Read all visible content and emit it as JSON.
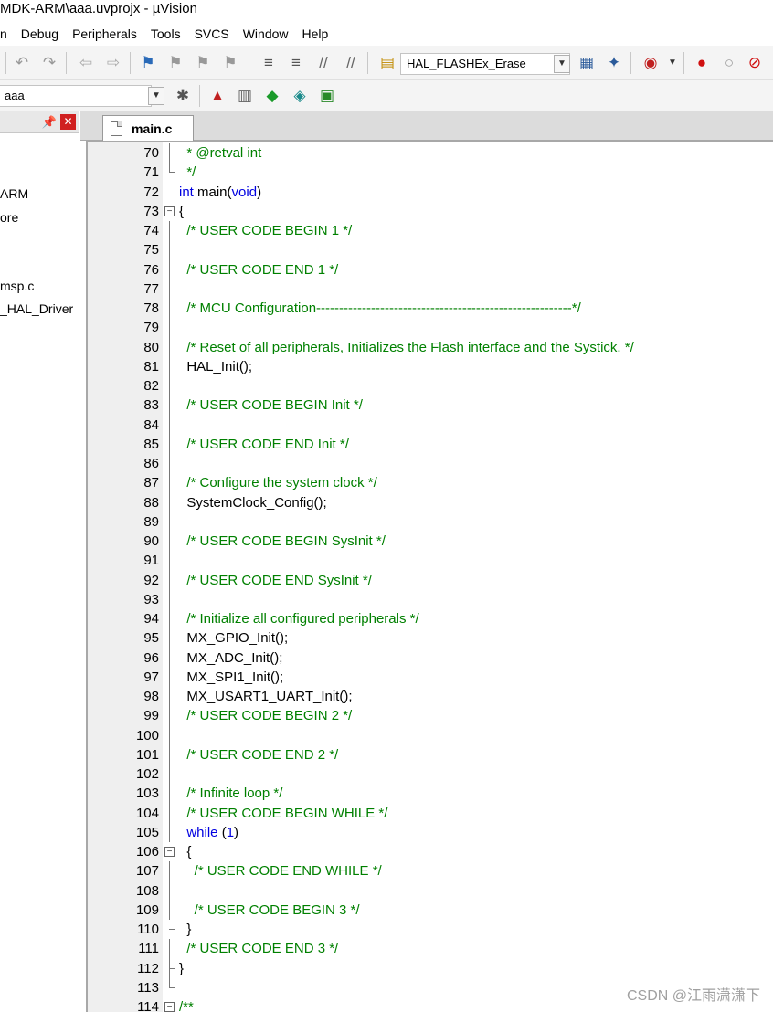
{
  "window": {
    "title": "MDK-ARM\\aaa.uvprojx - µVision"
  },
  "menu": [
    "n",
    "Debug",
    "Peripherals",
    "Tools",
    "SVCS",
    "Window",
    "Help"
  ],
  "toolbar": {
    "function_combo": "HAL_FLASHEx_Erase"
  },
  "toolbar2": {
    "target_combo": "aaa"
  },
  "project": {
    "items": [
      "ARM",
      "ore",
      "msp.c",
      "_HAL_Driver"
    ]
  },
  "tab": {
    "label": "main.c"
  },
  "code_lines": [
    {
      "n": "70",
      "t": "  * @retval int",
      "c": "c"
    },
    {
      "n": "71",
      "t": "  */",
      "c": "c"
    },
    {
      "n": "72",
      "t": "int main(void)",
      "c": "m"
    },
    {
      "n": "73",
      "t": "{",
      "c": "n"
    },
    {
      "n": "74",
      "t": "  /* USER CODE BEGIN 1 */",
      "c": "c"
    },
    {
      "n": "75",
      "t": "",
      "c": "n"
    },
    {
      "n": "76",
      "t": "  /* USER CODE END 1 */",
      "c": "c"
    },
    {
      "n": "77",
      "t": "",
      "c": "n"
    },
    {
      "n": "78",
      "t": "  /* MCU Configuration--------------------------------------------------------*/",
      "c": "c"
    },
    {
      "n": "79",
      "t": "",
      "c": "n"
    },
    {
      "n": "80",
      "t": "  /* Reset of all peripherals, Initializes the Flash interface and the Systick. */",
      "c": "c"
    },
    {
      "n": "81",
      "t": "  HAL_Init();",
      "c": "n"
    },
    {
      "n": "82",
      "t": "",
      "c": "n"
    },
    {
      "n": "83",
      "t": "  /* USER CODE BEGIN Init */",
      "c": "c"
    },
    {
      "n": "84",
      "t": "",
      "c": "n"
    },
    {
      "n": "85",
      "t": "  /* USER CODE END Init */",
      "c": "c"
    },
    {
      "n": "86",
      "t": "",
      "c": "n"
    },
    {
      "n": "87",
      "t": "  /* Configure the system clock */",
      "c": "c"
    },
    {
      "n": "88",
      "t": "  SystemClock_Config();",
      "c": "n"
    },
    {
      "n": "89",
      "t": "",
      "c": "n"
    },
    {
      "n": "90",
      "t": "  /* USER CODE BEGIN SysInit */",
      "c": "c"
    },
    {
      "n": "91",
      "t": "",
      "c": "n"
    },
    {
      "n": "92",
      "t": "  /* USER CODE END SysInit */",
      "c": "c"
    },
    {
      "n": "93",
      "t": "",
      "c": "n"
    },
    {
      "n": "94",
      "t": "  /* Initialize all configured peripherals */",
      "c": "c"
    },
    {
      "n": "95",
      "t": "  MX_GPIO_Init();",
      "c": "n"
    },
    {
      "n": "96",
      "t": "  MX_ADC_Init();",
      "c": "n"
    },
    {
      "n": "97",
      "t": "  MX_SPI1_Init();",
      "c": "n"
    },
    {
      "n": "98",
      "t": "  MX_USART1_UART_Init();",
      "c": "n"
    },
    {
      "n": "99",
      "t": "  /* USER CODE BEGIN 2 */",
      "c": "c"
    },
    {
      "n": "100",
      "t": "",
      "c": "n"
    },
    {
      "n": "101",
      "t": "  /* USER CODE END 2 */",
      "c": "c"
    },
    {
      "n": "102",
      "t": "",
      "c": "n"
    },
    {
      "n": "103",
      "t": "  /* Infinite loop */",
      "c": "c"
    },
    {
      "n": "104",
      "t": "  /* USER CODE BEGIN WHILE */",
      "c": "c"
    },
    {
      "n": "105",
      "t": "  while (1)",
      "c": "w"
    },
    {
      "n": "106",
      "t": "  {",
      "c": "n"
    },
    {
      "n": "107",
      "t": "    /* USER CODE END WHILE */",
      "c": "c"
    },
    {
      "n": "108",
      "t": "",
      "c": "n"
    },
    {
      "n": "109",
      "t": "    /* USER CODE BEGIN 3 */",
      "c": "c"
    },
    {
      "n": "110",
      "t": "  }",
      "c": "n"
    },
    {
      "n": "111",
      "t": "  /* USER CODE END 3 */",
      "c": "c"
    },
    {
      "n": "112",
      "t": "}",
      "c": "n"
    },
    {
      "n": "113",
      "t": "",
      "c": "n"
    },
    {
      "n": "114",
      "t": "/**",
      "c": "c"
    }
  ],
  "watermark": "CSDN @江雨潇潇下",
  "colors": {
    "comment": "#008000",
    "keyword": "#0000e0",
    "gutter": "#efefef"
  }
}
